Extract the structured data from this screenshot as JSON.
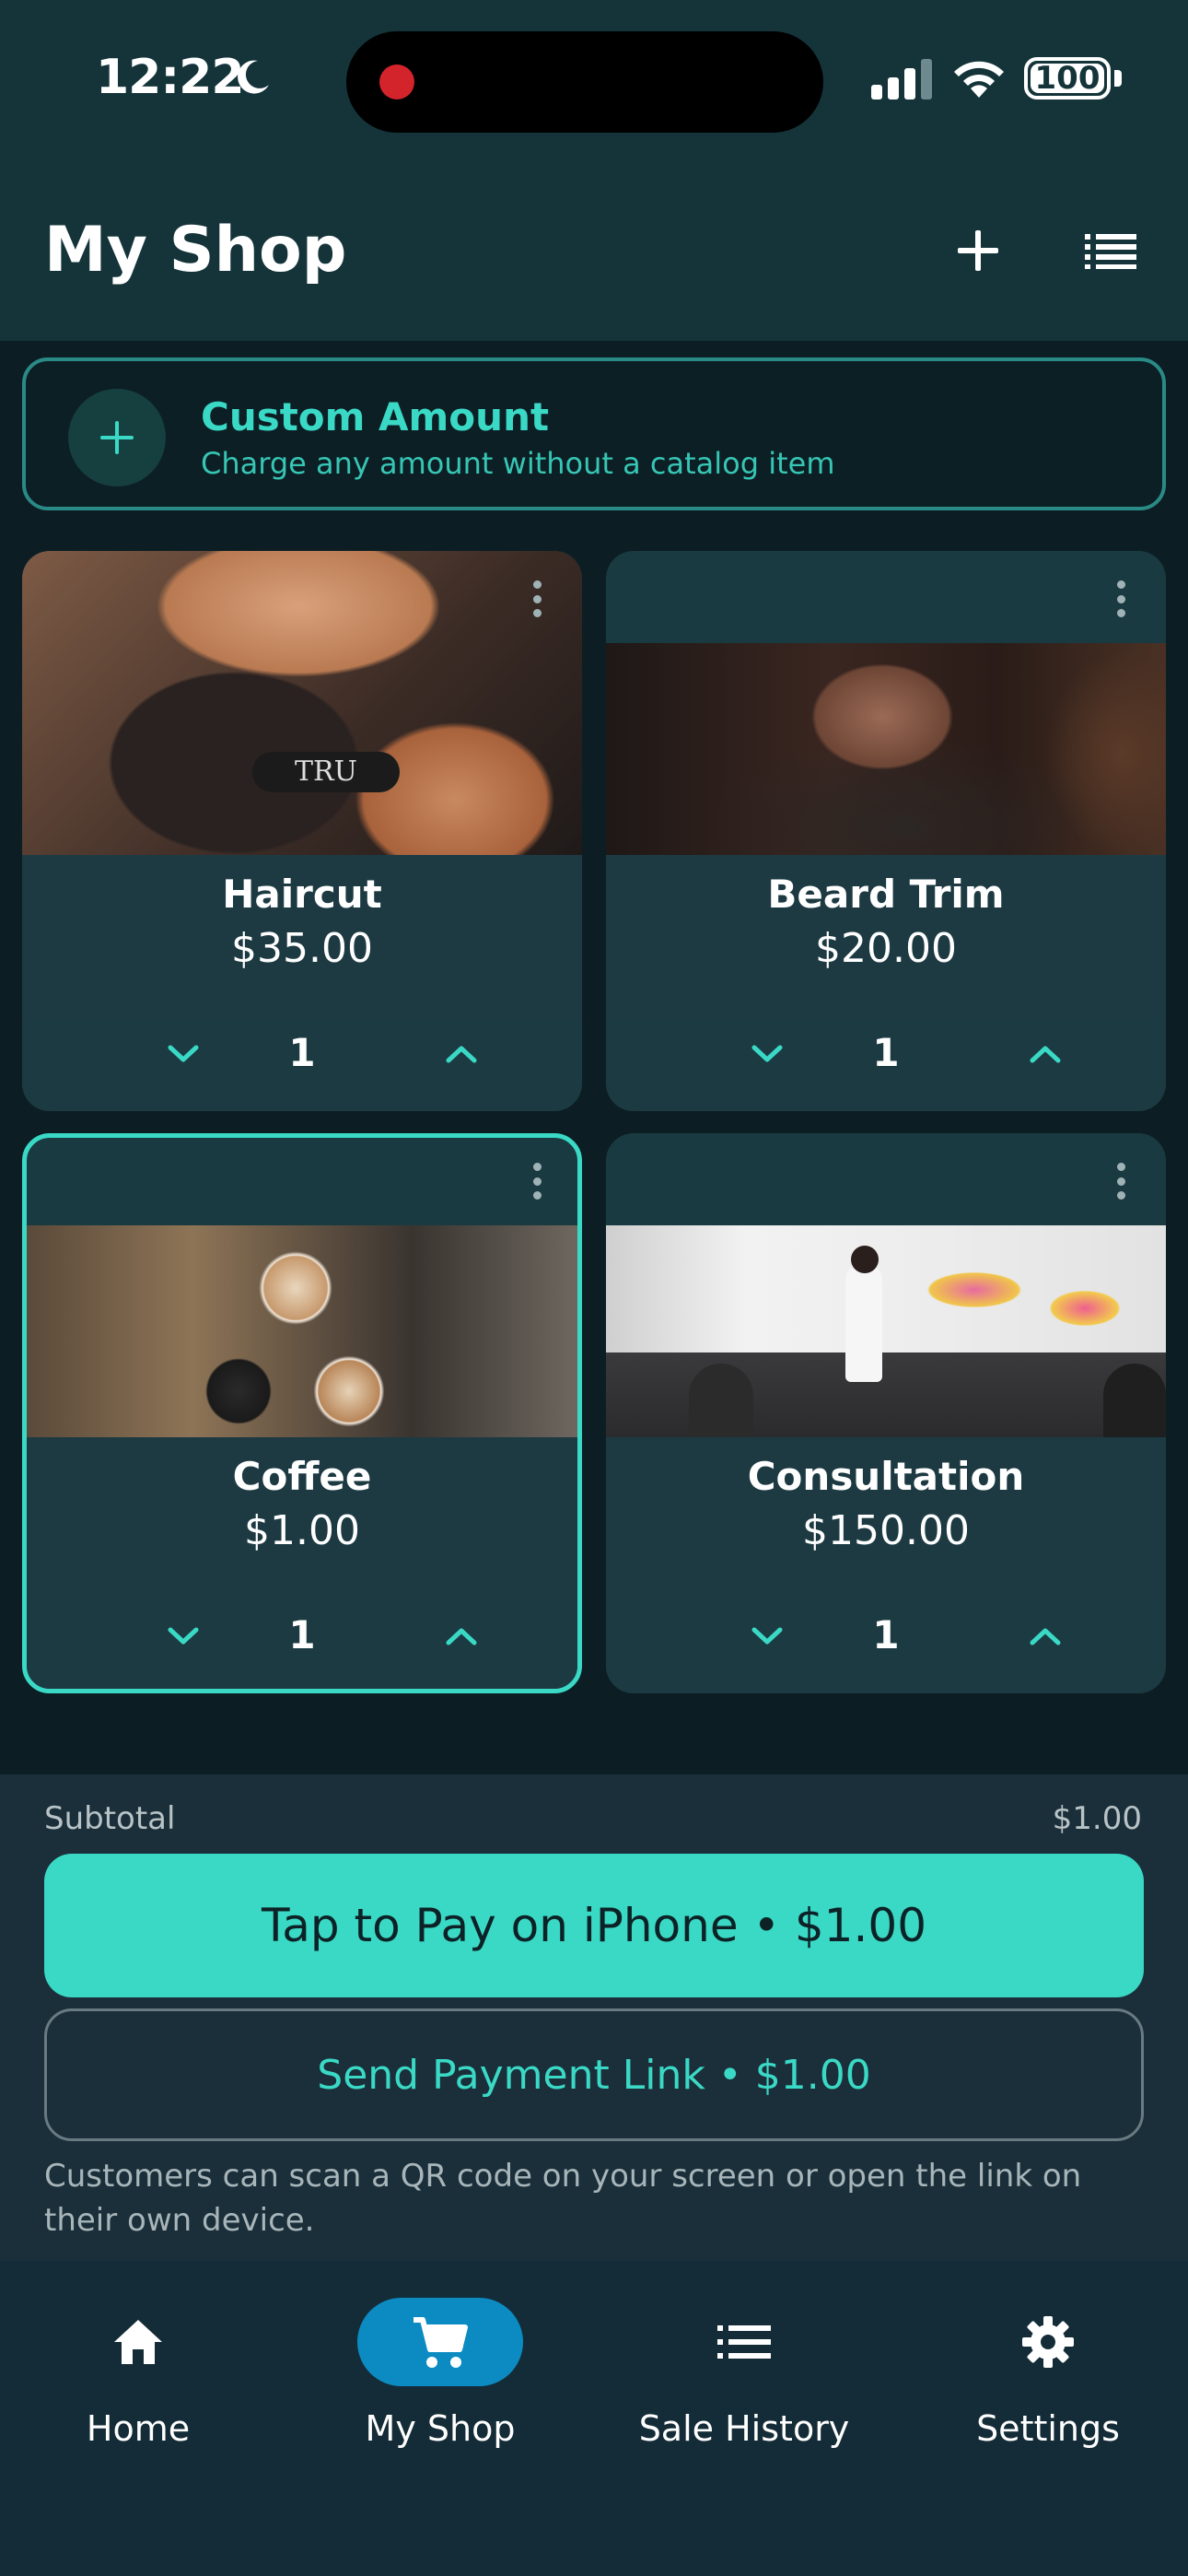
{
  "status_bar": {
    "time": "12:22",
    "battery": "100"
  },
  "header": {
    "title": "My Shop"
  },
  "custom_amount": {
    "title": "Custom Amount",
    "subtitle": "Charge any amount without a catalog item"
  },
  "catalog": {
    "items": [
      {
        "name": "Haircut",
        "price": "$35.00",
        "qty": "1",
        "selected": false
      },
      {
        "name": "Beard Trim",
        "price": "$20.00",
        "qty": "1",
        "selected": false
      },
      {
        "name": "Coffee",
        "price": "$1.00",
        "qty": "1",
        "selected": true
      },
      {
        "name": "Consultation",
        "price": "$150.00",
        "qty": "1",
        "selected": false
      }
    ]
  },
  "checkout": {
    "subtotal_label": "Subtotal",
    "subtotal_value": "$1.00",
    "pay_label": "Tap to Pay on iPhone • $1.00",
    "link_label": "Send Payment Link • $1.00",
    "helper_text": "Customers can scan a QR code on your screen or open the link on their own device."
  },
  "nav": {
    "items": [
      {
        "label": "Home",
        "icon": "home-icon",
        "active": false
      },
      {
        "label": "My Shop",
        "icon": "cart-icon",
        "active": true
      },
      {
        "label": "Sale History",
        "icon": "list-icon",
        "active": false
      },
      {
        "label": "Settings",
        "icon": "gear-icon",
        "active": false
      }
    ]
  },
  "colors": {
    "accent": "#3ad9c6",
    "header_bg": "#14343a",
    "page_bg": "#0c1e24",
    "nav_active": "#0b8bc2"
  }
}
